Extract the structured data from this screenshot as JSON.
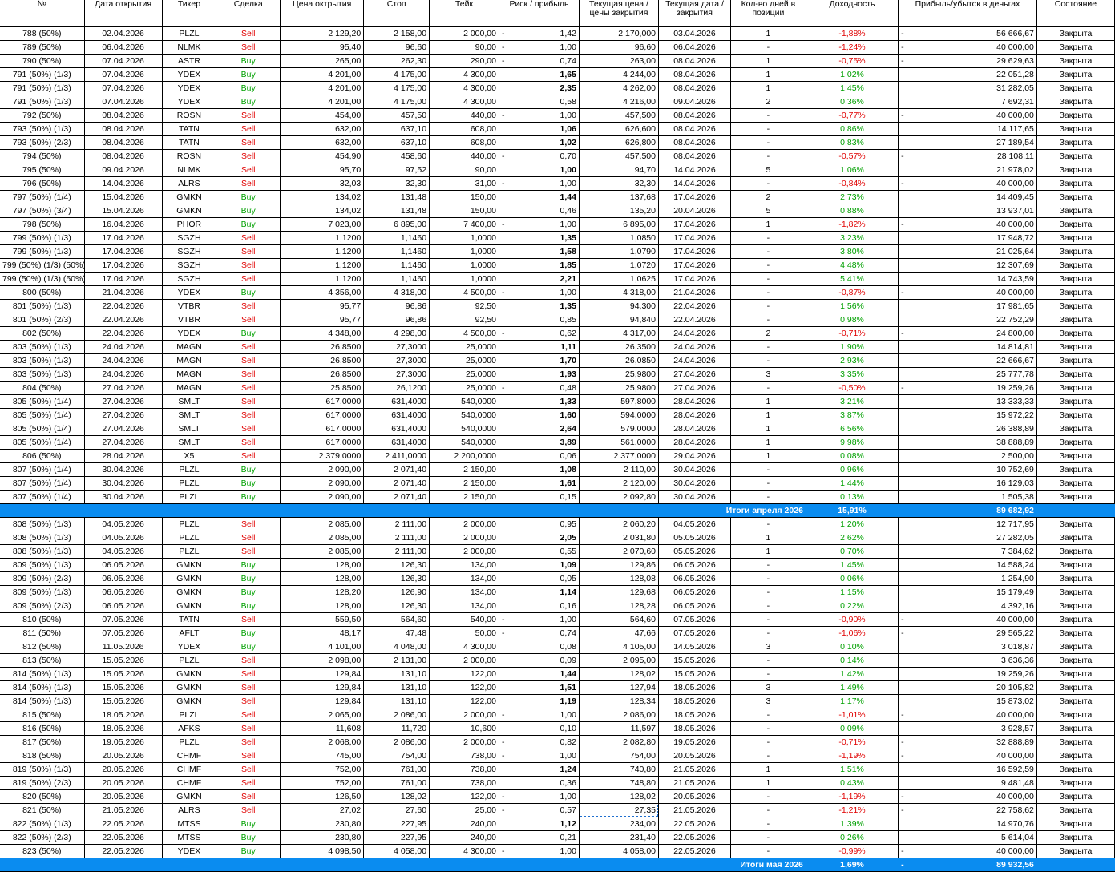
{
  "headers": [
    "№",
    "Дата открытия",
    "Тикер",
    "Сделка",
    "Цена октрытия",
    "Стоп",
    "Тейк",
    "Риск / прибыль",
    "Текущая цена / цены закрытия",
    "Текущая дата / закрытия",
    "Кол-во дней в позиции",
    "Доходность",
    "Прибыль/убыток в деньгах",
    "Состояние"
  ],
  "rows": [
    [
      "788 (50%)",
      "02.04.2026",
      "PLZL",
      "Sell",
      "2 129,20",
      "2 158,00",
      "2 000,00",
      "-",
      "1,42",
      "2 170,000",
      "03.04.2026",
      "1",
      "-1,88%",
      "-",
      "56 666,67",
      "Закрыта"
    ],
    [
      "789 (50%)",
      "06.04.2026",
      "NLMK",
      "Sell",
      "95,40",
      "96,60",
      "90,00",
      "-",
      "1,00",
      "96,60",
      "06.04.2026",
      "-",
      "-1,24%",
      "-",
      "40 000,00",
      "Закрыта"
    ],
    [
      "790 (50%)",
      "07.04.2026",
      "ASTR",
      "Buy",
      "265,00",
      "262,30",
      "290,00",
      "-",
      "0,74",
      "263,00",
      "08.04.2026",
      "1",
      "-0,75%",
      "-",
      "29 629,63",
      "Закрыта"
    ],
    [
      "791 (50%) (1/3)",
      "07.04.2026",
      "YDEX",
      "Buy",
      "4 201,00",
      "4 175,00",
      "4 300,00",
      "",
      "1,65",
      "4 244,00",
      "08.04.2026",
      "1",
      "1,02%",
      "",
      "22 051,28",
      "Закрыта"
    ],
    [
      "791 (50%) (1/3)",
      "07.04.2026",
      "YDEX",
      "Buy",
      "4 201,00",
      "4 175,00",
      "4 300,00",
      "",
      "2,35",
      "4 262,00",
      "08.04.2026",
      "1",
      "1,45%",
      "",
      "31 282,05",
      "Закрыта"
    ],
    [
      "791 (50%) (1/3)",
      "07.04.2026",
      "YDEX",
      "Buy",
      "4 201,00",
      "4 175,00",
      "4 300,00",
      "",
      "0,58",
      "4 216,00",
      "09.04.2026",
      "2",
      "0,36%",
      "",
      "7 692,31",
      "Закрыта"
    ],
    [
      "792 (50%)",
      "08.04.2026",
      "ROSN",
      "Sell",
      "454,00",
      "457,50",
      "440,00",
      "-",
      "1,00",
      "457,500",
      "08.04.2026",
      "-",
      "-0,77%",
      "-",
      "40 000,00",
      "Закрыта"
    ],
    [
      "793 (50%) (1/3)",
      "08.04.2026",
      "TATN",
      "Sell",
      "632,00",
      "637,10",
      "608,00",
      "",
      "1,06",
      "626,600",
      "08.04.2026",
      "-",
      "0,86%",
      "",
      "14 117,65",
      "Закрыта"
    ],
    [
      "793 (50%) (2/3)",
      "08.04.2026",
      "TATN",
      "Sell",
      "632,00",
      "637,10",
      "608,00",
      "",
      "1,02",
      "626,800",
      "08.04.2026",
      "-",
      "0,83%",
      "",
      "27 189,54",
      "Закрыта"
    ],
    [
      "794 (50%)",
      "08.04.2026",
      "ROSN",
      "Sell",
      "454,90",
      "458,60",
      "440,00",
      "-",
      "0,70",
      "457,500",
      "08.04.2026",
      "-",
      "-0,57%",
      "-",
      "28 108,11",
      "Закрыта"
    ],
    [
      "795 (50%)",
      "09.04.2026",
      "NLMK",
      "Sell",
      "95,70",
      "97,52",
      "90,00",
      "",
      "1,00",
      "94,70",
      "14.04.2026",
      "5",
      "1,06%",
      "",
      "21 978,02",
      "Закрыта"
    ],
    [
      "796 (50%)",
      "14.04.2026",
      "ALRS",
      "Sell",
      "32,03",
      "32,30",
      "31,00",
      "-",
      "1,00",
      "32,30",
      "14.04.2026",
      "-",
      "-0,84%",
      "-",
      "40 000,00",
      "Закрыта"
    ],
    [
      "797 (50%) (1/4)",
      "15.04.2026",
      "GMKN",
      "Buy",
      "134,02",
      "131,48",
      "150,00",
      "",
      "1,44",
      "137,68",
      "17.04.2026",
      "2",
      "2,73%",
      "",
      "14 409,45",
      "Закрыта"
    ],
    [
      "797 (50%) (3/4)",
      "15.04.2026",
      "GMKN",
      "Buy",
      "134,02",
      "131,48",
      "150,00",
      "",
      "0,46",
      "135,20",
      "20.04.2026",
      "5",
      "0,88%",
      "",
      "13 937,01",
      "Закрыта"
    ],
    [
      "798 (50%)",
      "16.04.2026",
      "PHOR",
      "Buy",
      "7 023,00",
      "6 895,00",
      "7 400,00",
      "-",
      "1,00",
      "6 895,00",
      "17.04.2026",
      "1",
      "-1,82%",
      "-",
      "40 000,00",
      "Закрыта"
    ],
    [
      "799 (50%) (1/3)",
      "17.04.2026",
      "SGZH",
      "Sell",
      "1,1200",
      "1,1460",
      "1,0000",
      "",
      "1,35",
      "1,0850",
      "17.04.2026",
      "-",
      "3,23%",
      "",
      "17 948,72",
      "Закрыта"
    ],
    [
      "799 (50%) (1/3)",
      "17.04.2026",
      "SGZH",
      "Sell",
      "1,1200",
      "1,1460",
      "1,0000",
      "",
      "1,58",
      "1,0790",
      "17.04.2026",
      "-",
      "3,80%",
      "",
      "21 025,64",
      "Закрыта"
    ],
    [
      "799 (50%) (1/3) (50%)",
      "17.04.2026",
      "SGZH",
      "Sell",
      "1,1200",
      "1,1460",
      "1,0000",
      "",
      "1,85",
      "1,0720",
      "17.04.2026",
      "-",
      "4,48%",
      "",
      "12 307,69",
      "Закрыта"
    ],
    [
      "799 (50%) (1/3) (50%)",
      "17.04.2026",
      "SGZH",
      "Sell",
      "1,1200",
      "1,1460",
      "1,0000",
      "",
      "2,21",
      "1,0625",
      "17.04.2026",
      "-",
      "5,41%",
      "",
      "14 743,59",
      "Закрыта"
    ],
    [
      "800 (50%)",
      "21.04.2026",
      "YDEX",
      "Buy",
      "4 356,00",
      "4 318,00",
      "4 500,00",
      "-",
      "1,00",
      "4 318,00",
      "21.04.2026",
      "-",
      "-0,87%",
      "-",
      "40 000,00",
      "Закрыта"
    ],
    [
      "801 (50%) (1/3)",
      "22.04.2026",
      "VTBR",
      "Sell",
      "95,77",
      "96,86",
      "92,50",
      "",
      "1,35",
      "94,300",
      "22.04.2026",
      "-",
      "1,56%",
      "",
      "17 981,65",
      "Закрыта"
    ],
    [
      "801 (50%) (2/3)",
      "22.04.2026",
      "VTBR",
      "Sell",
      "95,77",
      "96,86",
      "92,50",
      "",
      "0,85",
      "94,840",
      "22.04.2026",
      "-",
      "0,98%",
      "",
      "22 752,29",
      "Закрыта"
    ],
    [
      "802 (50%)",
      "22.04.2026",
      "YDEX",
      "Buy",
      "4 348,00",
      "4 298,00",
      "4 500,00",
      "-",
      "0,62",
      "4 317,00",
      "24.04.2026",
      "2",
      "-0,71%",
      "-",
      "24 800,00",
      "Закрыта"
    ],
    [
      "803 (50%) (1/3)",
      "24.04.2026",
      "MAGN",
      "Sell",
      "26,8500",
      "27,3000",
      "25,0000",
      "",
      "1,11",
      "26,3500",
      "24.04.2026",
      "-",
      "1,90%",
      "",
      "14 814,81",
      "Закрыта"
    ],
    [
      "803 (50%) (1/3)",
      "24.04.2026",
      "MAGN",
      "Sell",
      "26,8500",
      "27,3000",
      "25,0000",
      "",
      "1,70",
      "26,0850",
      "24.04.2026",
      "-",
      "2,93%",
      "",
      "22 666,67",
      "Закрыта"
    ],
    [
      "803 (50%) (1/3)",
      "24.04.2026",
      "MAGN",
      "Sell",
      "26,8500",
      "27,3000",
      "25,0000",
      "",
      "1,93",
      "25,9800",
      "27.04.2026",
      "3",
      "3,35%",
      "",
      "25 777,78",
      "Закрыта"
    ],
    [
      "804 (50%)",
      "27.04.2026",
      "MAGN",
      "Sell",
      "25,8500",
      "26,1200",
      "25,0000",
      "-",
      "0,48",
      "25,9800",
      "27.04.2026",
      "-",
      "-0,50%",
      "-",
      "19 259,26",
      "Закрыта"
    ],
    [
      "805 (50%) (1/4)",
      "27.04.2026",
      "SMLT",
      "Sell",
      "617,0000",
      "631,4000",
      "540,0000",
      "",
      "1,33",
      "597,8000",
      "28.04.2026",
      "1",
      "3,21%",
      "",
      "13 333,33",
      "Закрыта"
    ],
    [
      "805 (50%) (1/4)",
      "27.04.2026",
      "SMLT",
      "Sell",
      "617,0000",
      "631,4000",
      "540,0000",
      "",
      "1,60",
      "594,0000",
      "28.04.2026",
      "1",
      "3,87%",
      "",
      "15 972,22",
      "Закрыта"
    ],
    [
      "805 (50%) (1/4)",
      "27.04.2026",
      "SMLT",
      "Sell",
      "617,0000",
      "631,4000",
      "540,0000",
      "",
      "2,64",
      "579,0000",
      "28.04.2026",
      "1",
      "6,56%",
      "",
      "26 388,89",
      "Закрыта"
    ],
    [
      "805 (50%) (1/4)",
      "27.04.2026",
      "SMLT",
      "Sell",
      "617,0000",
      "631,4000",
      "540,0000",
      "",
      "3,89",
      "561,0000",
      "28.04.2026",
      "1",
      "9,98%",
      "",
      "38 888,89",
      "Закрыта"
    ],
    [
      "806 (50%)",
      "28.04.2026",
      "X5",
      "Sell",
      "2 379,0000",
      "2 411,0000",
      "2 200,0000",
      "",
      "0,06",
      "2 377,0000",
      "29.04.2026",
      "1",
      "0,08%",
      "",
      "2 500,00",
      "Закрыта"
    ],
    [
      "807 (50%) (1/4)",
      "30.04.2026",
      "PLZL",
      "Buy",
      "2 090,00",
      "2 071,40",
      "2 150,00",
      "",
      "1,08",
      "2 110,00",
      "30.04.2026",
      "-",
      "0,96%",
      "",
      "10 752,69",
      "Закрыта"
    ],
    [
      "807 (50%) (1/4)",
      "30.04.2026",
      "PLZL",
      "Buy",
      "2 090,00",
      "2 071,40",
      "2 150,00",
      "",
      "1,61",
      "2 120,00",
      "30.04.2026",
      "-",
      "1,44%",
      "",
      "16 129,03",
      "Закрыта"
    ],
    [
      "807 (50%) (1/4)",
      "30.04.2026",
      "PLZL",
      "Buy",
      "2 090,00",
      "2 071,40",
      "2 150,00",
      "",
      "0,15",
      "2 092,80",
      "30.04.2026",
      "-",
      "0,13%",
      "",
      "1 505,38",
      "Закрыта"
    ],
    {
      "total": true,
      "label": "Итоги апреля 2026",
      "pct": "15,91%",
      "dash": "",
      "money": "89 682,92"
    },
    [
      "808 (50%) (1/3)",
      "04.05.2026",
      "PLZL",
      "Sell",
      "2 085,00",
      "2 111,00",
      "2 000,00",
      "",
      "0,95",
      "2 060,20",
      "04.05.2026",
      "-",
      "1,20%",
      "",
      "12 717,95",
      "Закрыта"
    ],
    [
      "808 (50%) (1/3)",
      "04.05.2026",
      "PLZL",
      "Sell",
      "2 085,00",
      "2 111,00",
      "2 000,00",
      "",
      "2,05",
      "2 031,80",
      "05.05.2026",
      "1",
      "2,62%",
      "",
      "27 282,05",
      "Закрыта"
    ],
    [
      "808 (50%) (1/3)",
      "04.05.2026",
      "PLZL",
      "Sell",
      "2 085,00",
      "2 111,00",
      "2 000,00",
      "",
      "0,55",
      "2 070,60",
      "05.05.2026",
      "1",
      "0,70%",
      "",
      "7 384,62",
      "Закрыта"
    ],
    [
      "809 (50%) (1/3)",
      "06.05.2026",
      "GMKN",
      "Buy",
      "128,00",
      "126,30",
      "134,00",
      "",
      "1,09",
      "129,86",
      "06.05.2026",
      "-",
      "1,45%",
      "",
      "14 588,24",
      "Закрыта"
    ],
    [
      "809 (50%) (2/3)",
      "06.05.2026",
      "GMKN",
      "Buy",
      "128,00",
      "126,30",
      "134,00",
      "",
      "0,05",
      "128,08",
      "06.05.2026",
      "-",
      "0,06%",
      "",
      "1 254,90",
      "Закрыта"
    ],
    [
      "809 (50%) (1/3)",
      "06.05.2026",
      "GMKN",
      "Buy",
      "128,20",
      "126,90",
      "134,00",
      "",
      "1,14",
      "129,68",
      "06.05.2026",
      "-",
      "1,15%",
      "",
      "15 179,49",
      "Закрыта"
    ],
    [
      "809 (50%) (2/3)",
      "06.05.2026",
      "GMKN",
      "Buy",
      "128,00",
      "126,30",
      "134,00",
      "",
      "0,16",
      "128,28",
      "06.05.2026",
      "-",
      "0,22%",
      "",
      "4 392,16",
      "Закрыта"
    ],
    [
      "810 (50%)",
      "07.05.2026",
      "TATN",
      "Sell",
      "559,50",
      "564,60",
      "540,00",
      "-",
      "1,00",
      "564,60",
      "07.05.2026",
      "-",
      "-0,90%",
      "-",
      "40 000,00",
      "Закрыта"
    ],
    [
      "811 (50%)",
      "07.05.2026",
      "AFLT",
      "Buy",
      "48,17",
      "47,48",
      "50,00",
      "-",
      "0,74",
      "47,66",
      "07.05.2026",
      "-",
      "-1,06%",
      "-",
      "29 565,22",
      "Закрыта"
    ],
    [
      "812 (50%)",
      "11.05.2026",
      "YDEX",
      "Buy",
      "4 101,00",
      "4 048,00",
      "4 300,00",
      "",
      "0,08",
      "4 105,00",
      "14.05.2026",
      "3",
      "0,10%",
      "",
      "3 018,87",
      "Закрыта"
    ],
    [
      "813 (50%)",
      "15.05.2026",
      "PLZL",
      "Sell",
      "2 098,00",
      "2 131,00",
      "2 000,00",
      "",
      "0,09",
      "2 095,00",
      "15.05.2026",
      "-",
      "0,14%",
      "",
      "3 636,36",
      "Закрыта"
    ],
    [
      "814 (50%) (1/3)",
      "15.05.2026",
      "GMKN",
      "Sell",
      "129,84",
      "131,10",
      "122,00",
      "",
      "1,44",
      "128,02",
      "15.05.2026",
      "-",
      "1,42%",
      "",
      "19 259,26",
      "Закрыта"
    ],
    [
      "814 (50%) (1/3)",
      "15.05.2026",
      "GMKN",
      "Sell",
      "129,84",
      "131,10",
      "122,00",
      "",
      "1,51",
      "127,94",
      "18.05.2026",
      "3",
      "1,49%",
      "",
      "20 105,82",
      "Закрыта"
    ],
    [
      "814 (50%) (1/3)",
      "15.05.2026",
      "GMKN",
      "Sell",
      "129,84",
      "131,10",
      "122,00",
      "",
      "1,19",
      "128,34",
      "18.05.2026",
      "3",
      "1,17%",
      "",
      "15 873,02",
      "Закрыта"
    ],
    [
      "815 (50%)",
      "18.05.2026",
      "PLZL",
      "Sell",
      "2 065,00",
      "2 086,00",
      "2 000,00",
      "-",
      "1,00",
      "2 086,00",
      "18.05.2026",
      "-",
      "-1,01%",
      "-",
      "40 000,00",
      "Закрыта"
    ],
    [
      "816 (50%)",
      "18.05.2026",
      "AFKS",
      "Sell",
      "11,608",
      "11,720",
      "10,600",
      "",
      "0,10",
      "11,597",
      "18.05.2026",
      "-",
      "0,09%",
      "",
      "3 928,57",
      "Закрыта"
    ],
    [
      "817 (50%)",
      "19.05.2026",
      "PLZL",
      "Sell",
      "2 068,00",
      "2 086,00",
      "2 000,00",
      "-",
      "0,82",
      "2 082,80",
      "19.05.2026",
      "-",
      "-0,71%",
      "-",
      "32 888,89",
      "Закрыта"
    ],
    [
      "818 (50%)",
      "20.05.2026",
      "CHMF",
      "Sell",
      "745,00",
      "754,00",
      "738,00",
      "-",
      "1,00",
      "754,00",
      "20.05.2026",
      "-",
      "-1,19%",
      "-",
      "40 000,00",
      "Закрыта"
    ],
    [
      "819 (50%) (1/3)",
      "20.05.2026",
      "CHMF",
      "Sell",
      "752,00",
      "761,00",
      "738,00",
      "",
      "1,24",
      "740,80",
      "21.05.2026",
      "1",
      "1,51%",
      "",
      "16 592,59",
      "Закрыта"
    ],
    [
      "819 (50%) (2/3)",
      "20.05.2026",
      "CHMF",
      "Sell",
      "752,00",
      "761,00",
      "738,00",
      "",
      "0,36",
      "748,80",
      "21.05.2026",
      "1",
      "0,43%",
      "",
      "9 481,48",
      "Закрыта"
    ],
    [
      "820 (50%)",
      "20.05.2026",
      "GMKN",
      "Sell",
      "126,50",
      "128,02",
      "122,00",
      "-",
      "1,00",
      "128,02",
      "20.05.2026",
      "-",
      "-1,19%",
      "-",
      "40 000,00",
      "Закрыта"
    ],
    [
      "821 (50%)",
      "21.05.2026",
      "ALRS",
      "Sell",
      "27,02",
      "27,60",
      "25,00",
      "-",
      "0,57",
      "27,35",
      "21.05.2026",
      "-",
      "-1,21%",
      "-",
      "22 758,62",
      "Закрыта"
    ],
    [
      "822 (50%) (1/3)",
      "22.05.2026",
      "MTSS",
      "Buy",
      "230,80",
      "227,95",
      "240,00",
      "",
      "1,12",
      "234,00",
      "22.05.2026",
      "-",
      "1,39%",
      "",
      "14 970,76",
      "Закрыта"
    ],
    [
      "822 (50%) (2/3)",
      "22.05.2026",
      "MTSS",
      "Buy",
      "230,80",
      "227,95",
      "240,00",
      "",
      "0,21",
      "231,40",
      "22.05.2026",
      "-",
      "0,26%",
      "",
      "5 614,04",
      "Закрыта"
    ],
    [
      "823 (50%)",
      "22.05.2026",
      "YDEX",
      "Buy",
      "4 098,50",
      "4 058,00",
      "4 300,00",
      "-",
      "1,00",
      "4 058,00",
      "22.05.2026",
      "-",
      "-0,99%",
      "-",
      "40 000,00",
      "Закрыта"
    ],
    {
      "total": true,
      "label": "Итоги мая 2026",
      "pct": "1,69%",
      "dash": "-",
      "money": "89 932,56"
    }
  ],
  "colors": {
    "sell": "#e00000",
    "buy": "#00a000",
    "total_bg": "#0a8cf0"
  }
}
